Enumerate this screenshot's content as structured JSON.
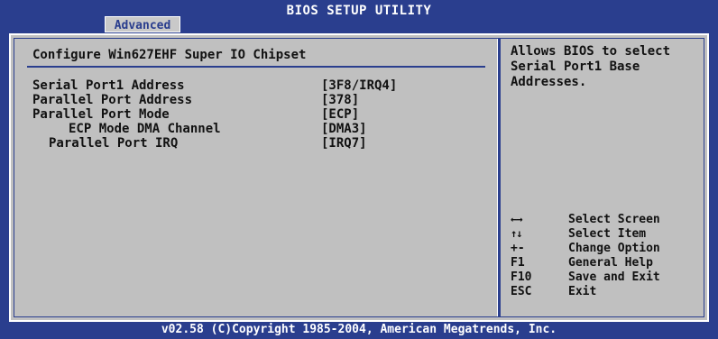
{
  "title": "BIOS SETUP UTILITY",
  "active_tab": "Advanced",
  "section_heading": "Configure Win627EHF Super IO Chipset",
  "settings": [
    {
      "label": "Serial Port1 Address",
      "value": "[3F8/IRQ4]"
    },
    {
      "label": "Parallel Port Address",
      "value": "[378]"
    },
    {
      "label": "Parallel Port Mode",
      "value": "[ECP]"
    },
    {
      "label": "ECP Mode DMA Channel",
      "value": "[DMA3]"
    },
    {
      "label": "Parallel Port IRQ",
      "value": "[IRQ7]"
    }
  ],
  "help_text": "Allows BIOS to select\nSerial Port1 Base\nAddresses.",
  "key_help": [
    {
      "key": "←→",
      "desc": "Select Screen"
    },
    {
      "key": "↑↓",
      "desc": "Select Item"
    },
    {
      "key": "+-",
      "desc": "Change Option"
    },
    {
      "key": "F1",
      "desc": "General Help"
    },
    {
      "key": "F10",
      "desc": "Save and Exit"
    },
    {
      "key": "ESC",
      "desc": "Exit"
    }
  ],
  "footer": "v02.58 (C)Copyright 1985-2004, American Megatrends, Inc.",
  "colors": {
    "background": "#2a3e8e",
    "panel": "#c0c0c0",
    "text": "#111111",
    "highlight_text": "#ffffff"
  }
}
